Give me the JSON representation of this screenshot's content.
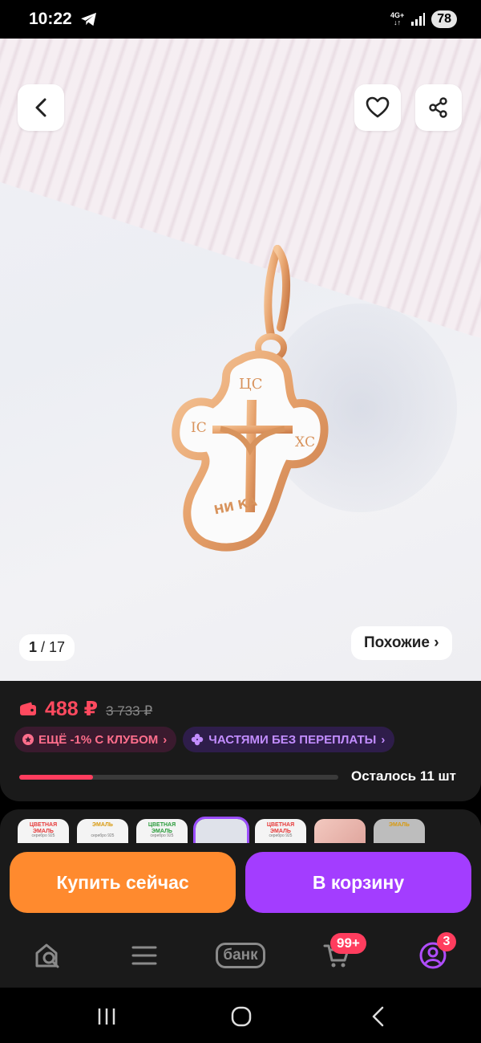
{
  "status_bar": {
    "time": "10:22",
    "network_top": "4G+",
    "network_bottom": "↓↑",
    "battery": "78"
  },
  "gallery": {
    "current": "1",
    "total": "/ 17",
    "similar_label": "Похожие ›",
    "cross_text_ic": "ІС",
    "cross_text_xc": "ХС",
    "cross_text_top": "ЦС",
    "cross_text_nika": "НИ КА"
  },
  "pricing": {
    "price": "488 ₽",
    "old_price": "3 733 ₽",
    "club_badge": "ЕЩЁ -1% С КЛУБОМ",
    "parts_badge": "ЧАСТЯМИ БЕЗ ПЕРЕПЛАТЫ",
    "stock_text": "Осталось 11 шт",
    "stock_fraction": 0.23,
    "colors": {
      "price": "#ff4a5f",
      "club": "#ff6e8c",
      "parts": "#c28dff"
    }
  },
  "thumbnails": [
    {
      "t1": "ЦВЕТНАЯ ЭМАЛЬ",
      "t2": "серебро 925"
    },
    {
      "t1": "ЭМАЛЬ",
      "t2": "серебро 925"
    },
    {
      "t1": "ЦВЕТНАЯ ЭМАЛЬ",
      "t2": "серебро 925"
    },
    {
      "t1": "",
      "t2": ""
    },
    {
      "t1": "ЦВЕТНАЯ ЭМАЛЬ",
      "t2": "серебро 925"
    },
    {
      "t1": "",
      "t2": ""
    },
    {
      "t1": "ЭМАЛЬ",
      "t2": ""
    }
  ],
  "actions": {
    "buy_now": "Купить сейчас",
    "add_to_cart": "В корзину",
    "colors": {
      "buy": "#ff8a2e",
      "cart": "#a33dff"
    }
  },
  "bottom_nav": {
    "bank_label": "банк",
    "cart_badge": "99+",
    "profile_badge": "3",
    "icons": [
      "home-search-icon",
      "catalog-icon",
      "bank-icon",
      "cart-icon",
      "profile-icon"
    ]
  }
}
